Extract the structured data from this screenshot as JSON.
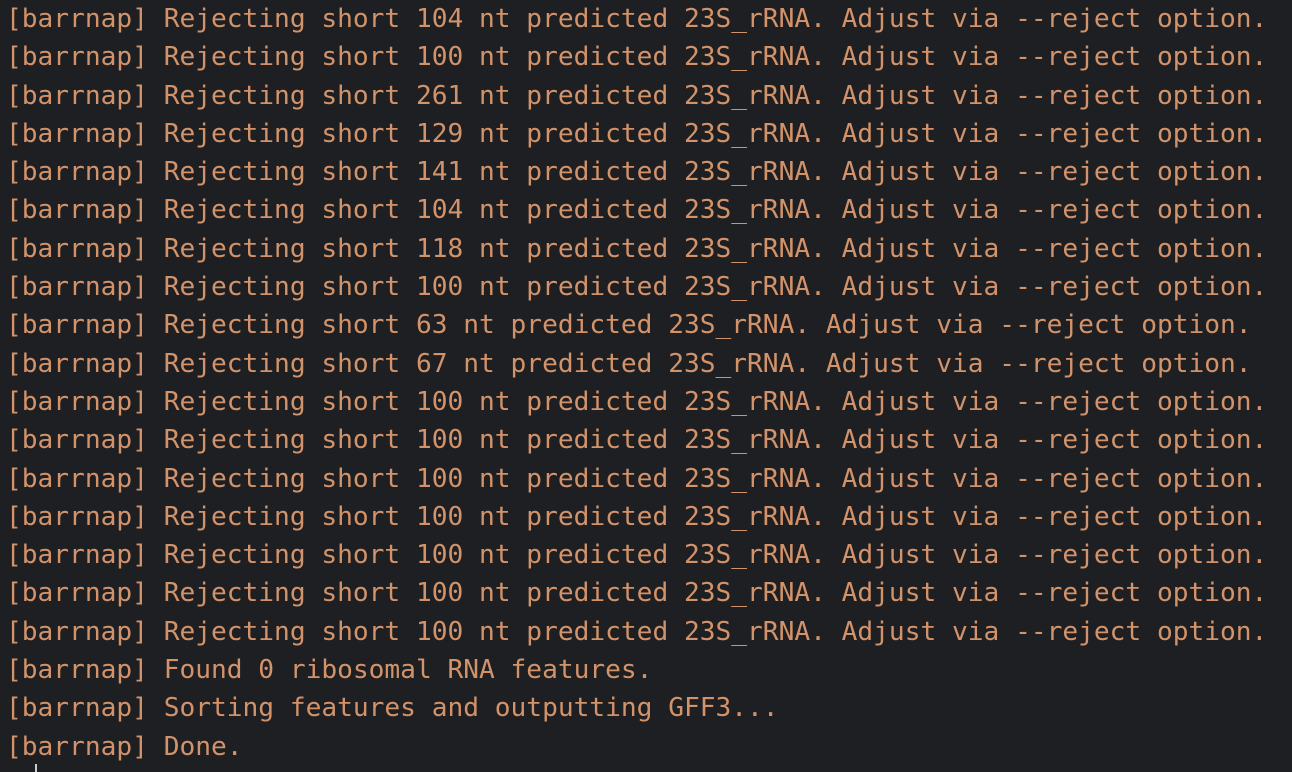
{
  "terminal": {
    "colors": {
      "background": "#1e1f22",
      "warning_text": "#d3936a",
      "plain_text": "#c9cdd3"
    },
    "lines": [
      {
        "tag": "[barrnap]",
        "msg": "Rejecting short 104 nt predicted 23S_rRNA. Adjust via --reject option.",
        "kind": "warning"
      },
      {
        "tag": "[barrnap]",
        "msg": "Rejecting short 100 nt predicted 23S_rRNA. Adjust via --reject option.",
        "kind": "warning"
      },
      {
        "tag": "[barrnap]",
        "msg": "Rejecting short 261 nt predicted 23S_rRNA. Adjust via --reject option.",
        "kind": "warning"
      },
      {
        "tag": "[barrnap]",
        "msg": "Rejecting short 129 nt predicted 23S_rRNA. Adjust via --reject option.",
        "kind": "warning"
      },
      {
        "tag": "[barrnap]",
        "msg": "Rejecting short 141 nt predicted 23S_rRNA. Adjust via --reject option.",
        "kind": "warning"
      },
      {
        "tag": "[barrnap]",
        "msg": "Rejecting short 104 nt predicted 23S_rRNA. Adjust via --reject option.",
        "kind": "warning"
      },
      {
        "tag": "[barrnap]",
        "msg": "Rejecting short 118 nt predicted 23S_rRNA. Adjust via --reject option.",
        "kind": "warning"
      },
      {
        "tag": "[barrnap]",
        "msg": "Rejecting short 100 nt predicted 23S_rRNA. Adjust via --reject option.",
        "kind": "warning"
      },
      {
        "tag": "[barrnap]",
        "msg": "Rejecting short 63 nt predicted 23S_rRNA. Adjust via --reject option.",
        "kind": "warning"
      },
      {
        "tag": "[barrnap]",
        "msg": "Rejecting short 67 nt predicted 23S_rRNA. Adjust via --reject option.",
        "kind": "warning"
      },
      {
        "tag": "[barrnap]",
        "msg": "Rejecting short 100 nt predicted 23S_rRNA. Adjust via --reject option.",
        "kind": "warning"
      },
      {
        "tag": "[barrnap]",
        "msg": "Rejecting short 100 nt predicted 23S_rRNA. Adjust via --reject option.",
        "kind": "warning"
      },
      {
        "tag": "[barrnap]",
        "msg": "Rejecting short 100 nt predicted 23S_rRNA. Adjust via --reject option.",
        "kind": "warning"
      },
      {
        "tag": "[barrnap]",
        "msg": "Rejecting short 100 nt predicted 23S_rRNA. Adjust via --reject option.",
        "kind": "warning"
      },
      {
        "tag": "[barrnap]",
        "msg": "Rejecting short 100 nt predicted 23S_rRNA. Adjust via --reject option.",
        "kind": "warning"
      },
      {
        "tag": "[barrnap]",
        "msg": "Rejecting short 100 nt predicted 23S_rRNA. Adjust via --reject option.",
        "kind": "warning"
      },
      {
        "tag": "[barrnap]",
        "msg": "Rejecting short 100 nt predicted 23S_rRNA. Adjust via --reject option.",
        "kind": "warning"
      },
      {
        "tag": "[barrnap]",
        "msg": "Found 0 ribosomal RNA features.",
        "kind": "warning"
      },
      {
        "tag": "[barrnap]",
        "msg": "Sorting features and outputting GFF3...",
        "kind": "warning"
      },
      {
        "tag": "[barrnap]",
        "msg": "Done.",
        "kind": "warning"
      }
    ]
  }
}
